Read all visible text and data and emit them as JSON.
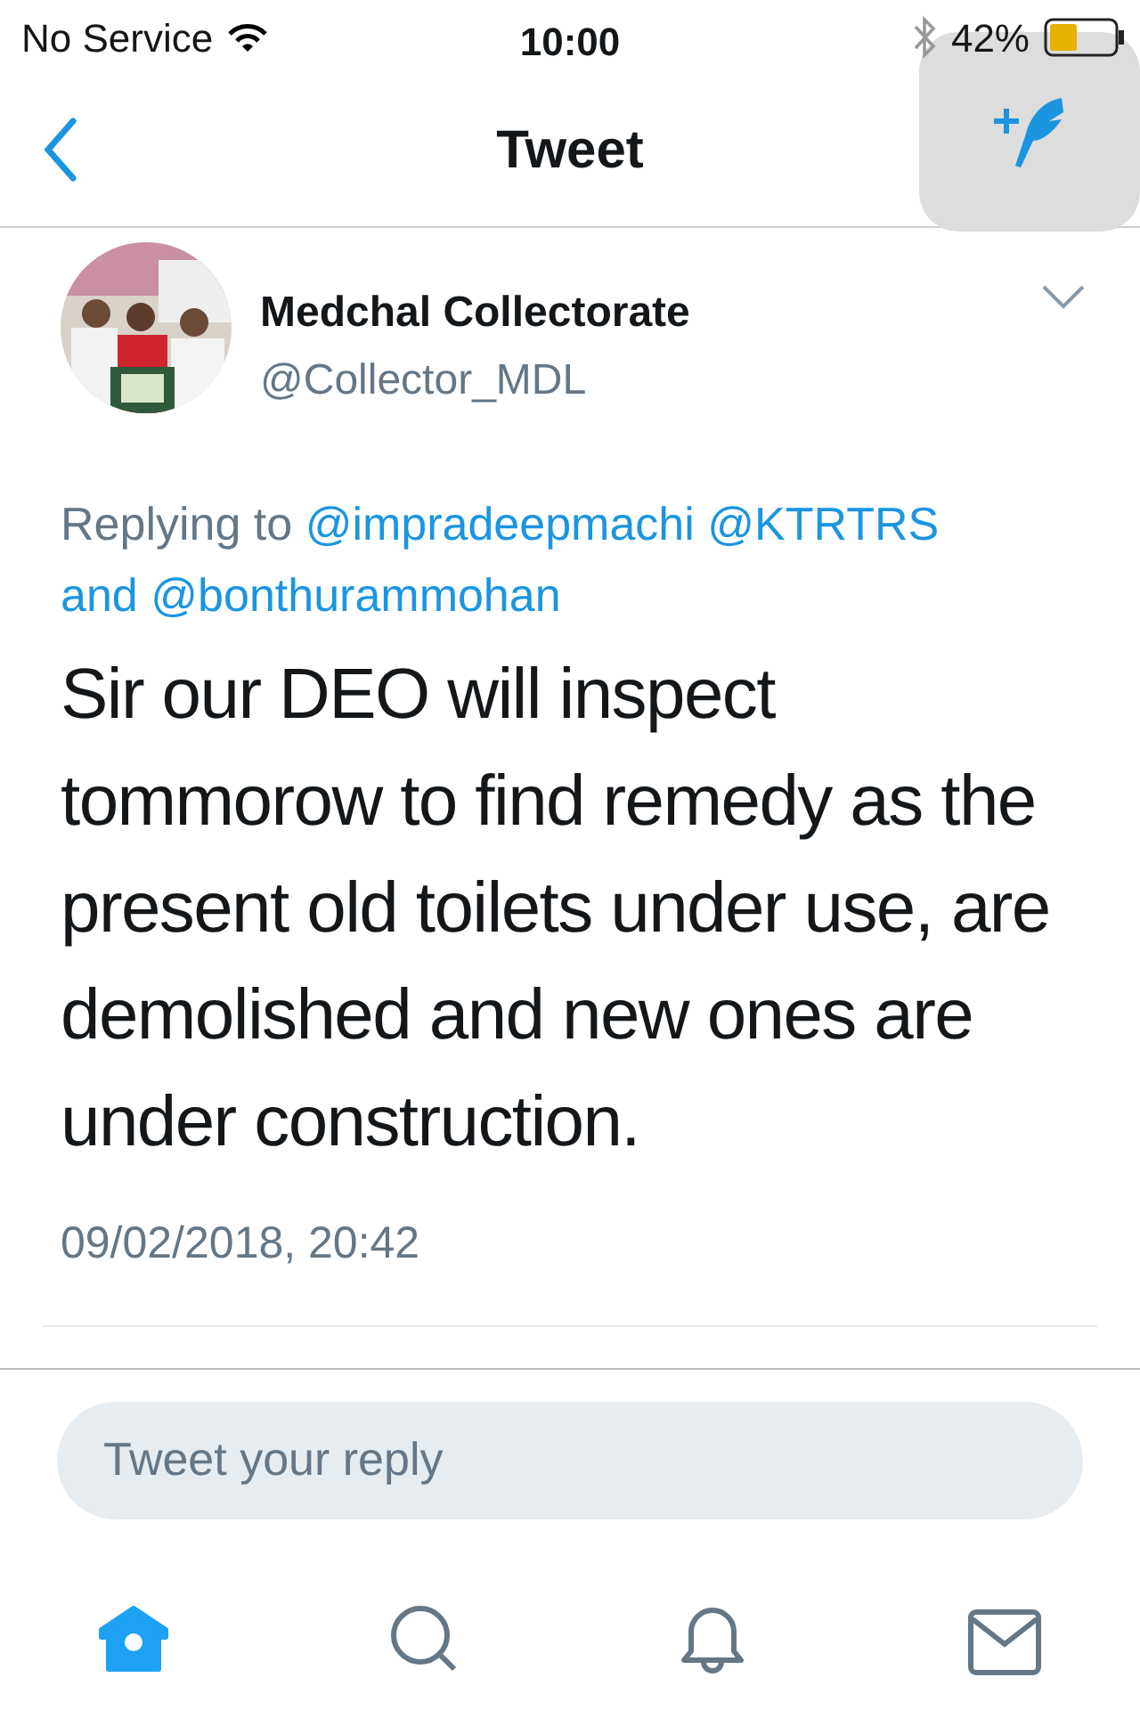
{
  "status_bar": {
    "carrier": "No Service",
    "time": "10:00",
    "battery": "42%"
  },
  "nav": {
    "title": "Tweet"
  },
  "tweet": {
    "name": "Medchal Collectorate",
    "handle": "@Collector_MDL",
    "replying": [
      {
        "kind": "label",
        "text": "Replying to"
      },
      {
        "kind": "mention",
        "text": "@impradeepmachi"
      },
      {
        "kind": "mention",
        "text": "@KTRTRS"
      },
      {
        "kind": "mention",
        "text": "and"
      },
      {
        "kind": "mention",
        "text": "@bonthurammohan"
      }
    ],
    "text": "Sir our DEO will inspect tommorow to find remedy as the present old toilets under use, are demolished and new ones are under construction.",
    "timestamp": "09/02/2018, 20:42"
  },
  "reply": {
    "placeholder": "Tweet your reply"
  },
  "tab_bar": [
    {
      "kind": "home",
      "selected": true
    },
    {
      "kind": "search",
      "selected": false
    },
    {
      "kind": "notifications",
      "selected": false
    },
    {
      "kind": "messages",
      "selected": false
    }
  ]
}
